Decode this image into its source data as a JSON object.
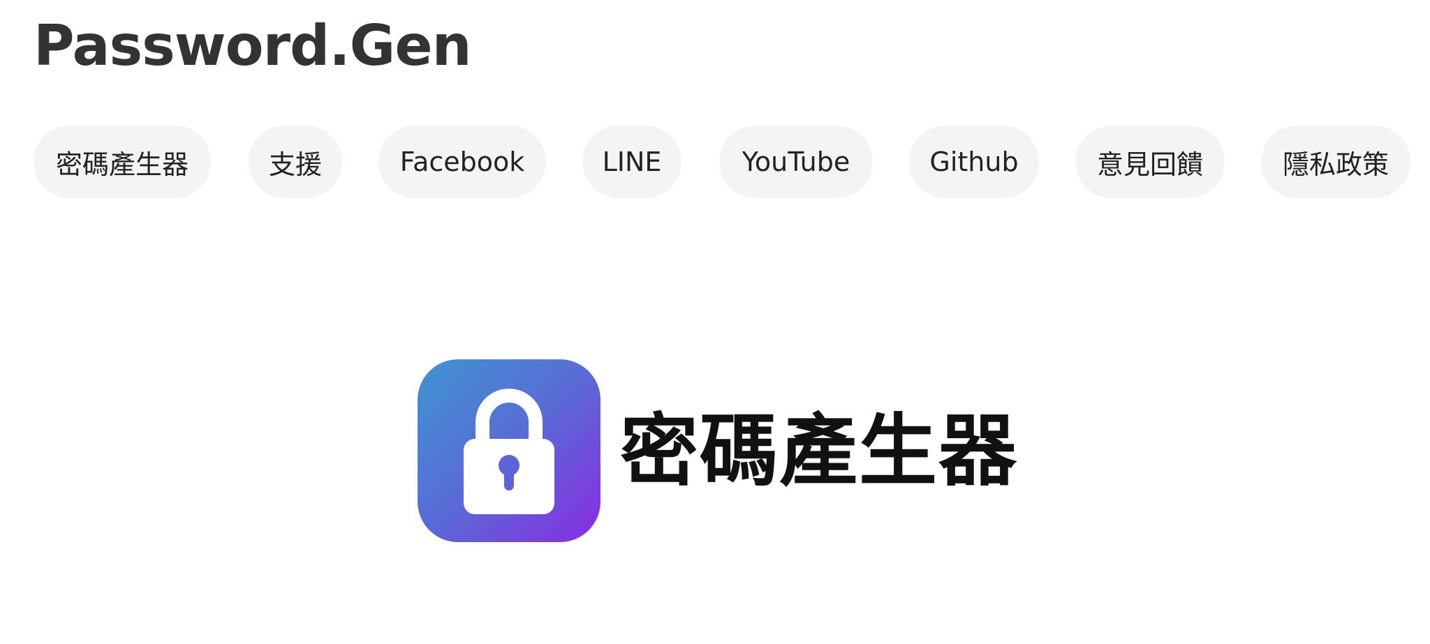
{
  "header": {
    "title": "Password.Gen"
  },
  "nav": {
    "items": [
      {
        "label": "密碼產生器"
      },
      {
        "label": "支援"
      },
      {
        "label": "Facebook"
      },
      {
        "label": "LINE"
      },
      {
        "label": "YouTube"
      },
      {
        "label": "Github"
      },
      {
        "label": "意見回饋"
      },
      {
        "label": "隱私政策"
      }
    ]
  },
  "hero": {
    "icon": "padlock-icon",
    "title": "密碼產生器"
  },
  "colors": {
    "nav_pill_bg": "#f4f4f4",
    "icon_gradient_start": "#3f94d1",
    "icon_gradient_end": "#8a2be2",
    "title_text": "#333333"
  }
}
